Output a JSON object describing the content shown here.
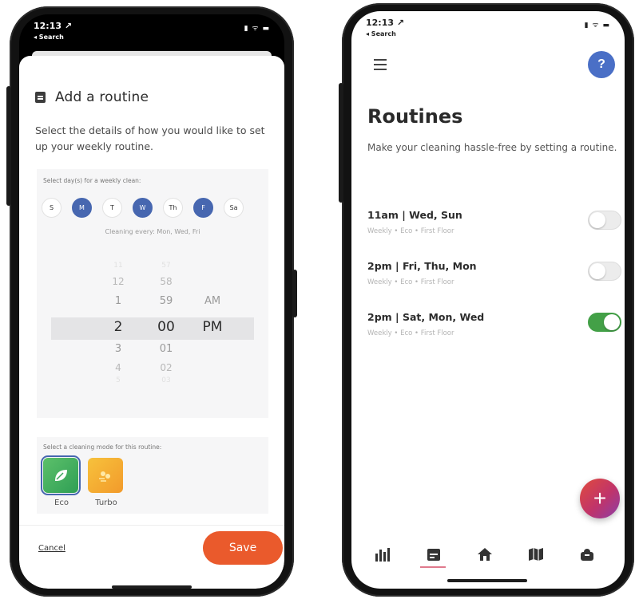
{
  "left_screen": {
    "status": {
      "time": "12:13 ↗",
      "back": "◂ Search"
    },
    "title": "Add a routine",
    "description": "Select the details of how you would like to set up your weekly routine.",
    "days_label": "Select day(s) for a weekly clean:",
    "days": [
      {
        "label": "S",
        "selected": false
      },
      {
        "label": "M",
        "selected": true
      },
      {
        "label": "T",
        "selected": false
      },
      {
        "label": "W",
        "selected": true
      },
      {
        "label": "Th",
        "selected": false
      },
      {
        "label": "F",
        "selected": true
      },
      {
        "label": "Sa",
        "selected": false
      }
    ],
    "cleaning_every": "Cleaning every: Mon, Wed, Fri",
    "picker": {
      "hours": [
        "11",
        "12",
        "1",
        "2",
        "3",
        "4",
        "5"
      ],
      "minutes": [
        "57",
        "58",
        "59",
        "00",
        "01",
        "02",
        "03"
      ],
      "ampm": [
        "AM",
        "PM"
      ],
      "selected": {
        "hour": "2",
        "minute": "00",
        "ampm": "PM"
      }
    },
    "mode_label": "Select a cleaning mode for this routine:",
    "modes": [
      {
        "label": "Eco",
        "selected": true
      },
      {
        "label": "Turbo",
        "selected": false
      }
    ],
    "cancel": "Cancel",
    "save": "Save"
  },
  "right_screen": {
    "status": {
      "time": "12:13 ↗",
      "back": "◂ Search"
    },
    "help": "?",
    "title": "Routines",
    "subtitle": "Make your cleaning hassle-free by setting a routine.",
    "routines": [
      {
        "title": "11am | Wed, Sun",
        "sub": "Weekly • Eco • First Floor",
        "enabled": false
      },
      {
        "title": "2pm | Fri, Thu, Mon",
        "sub": "Weekly • Eco • First Floor",
        "enabled": false
      },
      {
        "title": "2pm | Sat, Mon, Wed",
        "sub": "Weekly • Eco • First Floor",
        "enabled": true
      }
    ],
    "fab": "+",
    "tabs": [
      "stats-icon",
      "calendar-icon",
      "home-icon",
      "map-icon",
      "robot-icon"
    ],
    "active_tab": "calendar-icon"
  },
  "colors": {
    "accent_blue": "#4767b0",
    "save_orange": "#ea5a2c",
    "toggle_green": "#43a047"
  }
}
